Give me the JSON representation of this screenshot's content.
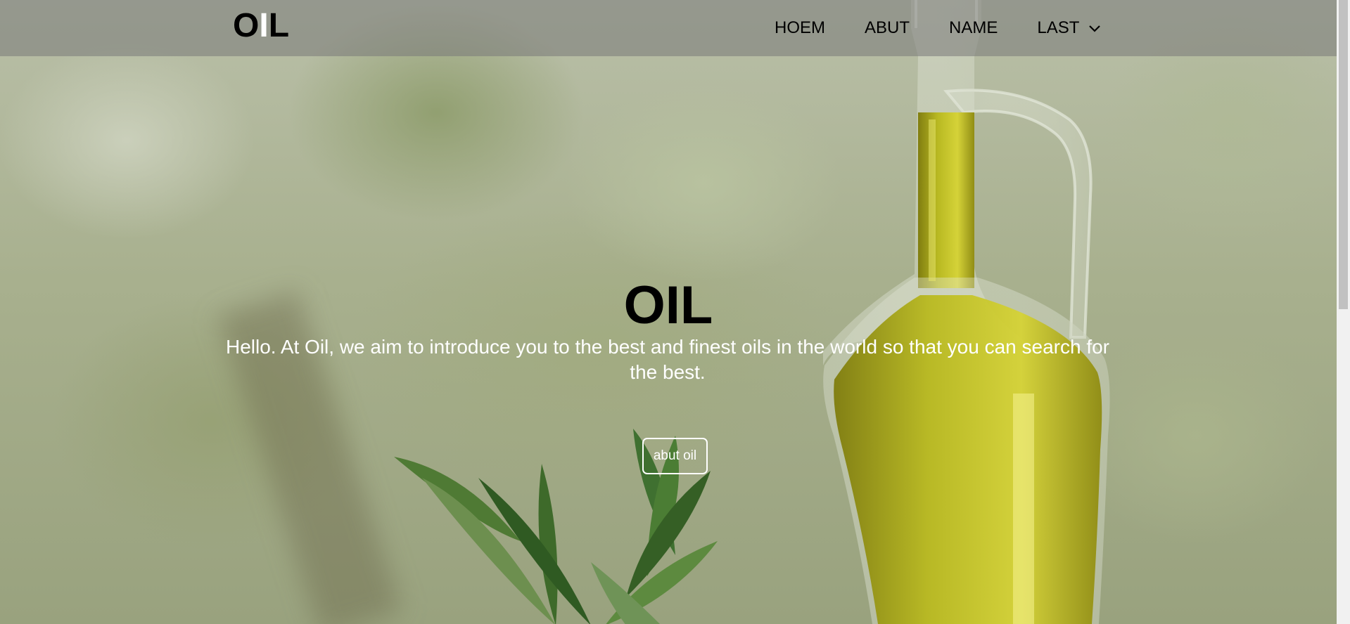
{
  "header": {
    "logo": {
      "part1": "O",
      "part2": "I",
      "part3": "L"
    },
    "nav": [
      {
        "label": "HOEM"
      },
      {
        "label": "ABUT"
      },
      {
        "label": "NAME"
      },
      {
        "label": "LAST",
        "icon": "chevron-down-icon"
      }
    ]
  },
  "hero": {
    "title": "OIL",
    "text": "Hello. At Oil, we aim to introduce you to the best and finest oils in the world so that you can search for the best.",
    "button_label": "abut oil"
  },
  "colors": {
    "nav_bg": "#787878",
    "text_dark": "#000000",
    "text_light": "#ffffff",
    "oil": "#b8b81a"
  }
}
